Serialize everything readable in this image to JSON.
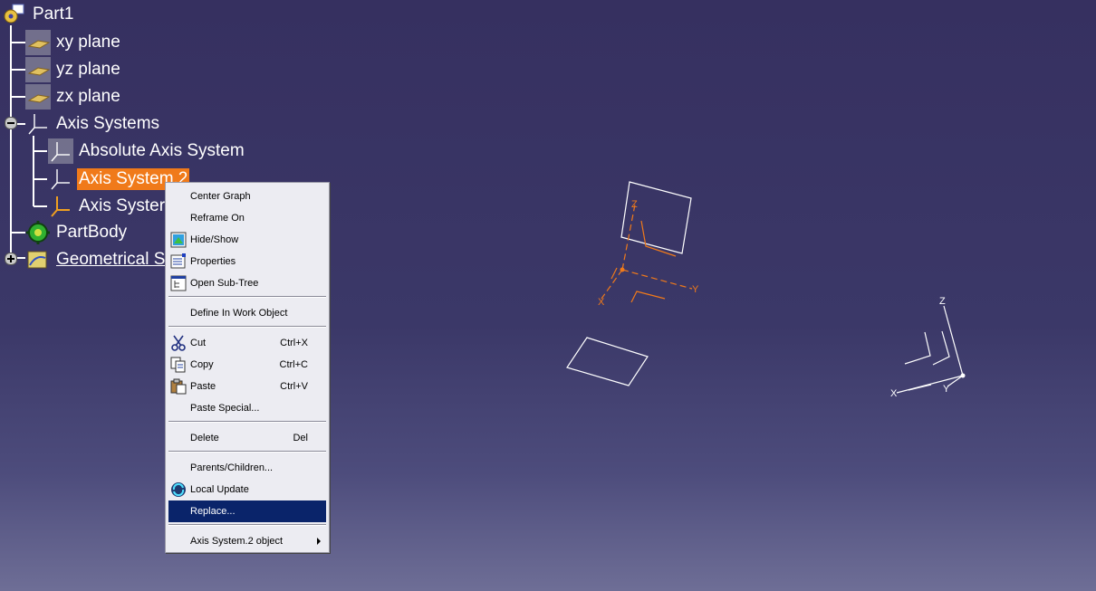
{
  "tree": {
    "root": "Part1",
    "xy_plane": "xy plane",
    "yz_plane": "yz plane",
    "zx_plane": "zx plane",
    "axis_systems": "Axis Systems",
    "absolute_axis": "Absolute Axis System",
    "axis_system_2": "Axis System.2",
    "axis_system_3": "Axis Syster",
    "part_body": "PartBody",
    "geometrical_set": "Geometrical S"
  },
  "menu": {
    "center_graph": "Center Graph",
    "reframe_on": "Reframe On",
    "hide_show": "Hide/Show",
    "properties": "Properties",
    "open_subtree": "Open Sub-Tree",
    "define_in_work": "Define In Work Object",
    "cut": "Cut",
    "cut_short": "Ctrl+X",
    "copy": "Copy",
    "copy_short": "Ctrl+C",
    "paste": "Paste",
    "paste_short": "Ctrl+V",
    "paste_special": "Paste Special...",
    "delete": "Delete",
    "delete_short": "Del",
    "parents_children": "Parents/Children...",
    "local_update": "Local Update",
    "replace": "Replace...",
    "object_submenu": "Axis System.2 object"
  },
  "viewport": {
    "axis_orange_z": "Z",
    "axis_orange_y": "Y",
    "axis_orange_x": "X",
    "axis_white_z": "Z",
    "axis_white_y": "Y",
    "axis_white_x": "X"
  },
  "colors": {
    "selection": "#f07a1a",
    "menu_highlight": "#0a246a",
    "axis_orange": "#f07a1a",
    "geometry_white": "#ffffff"
  }
}
